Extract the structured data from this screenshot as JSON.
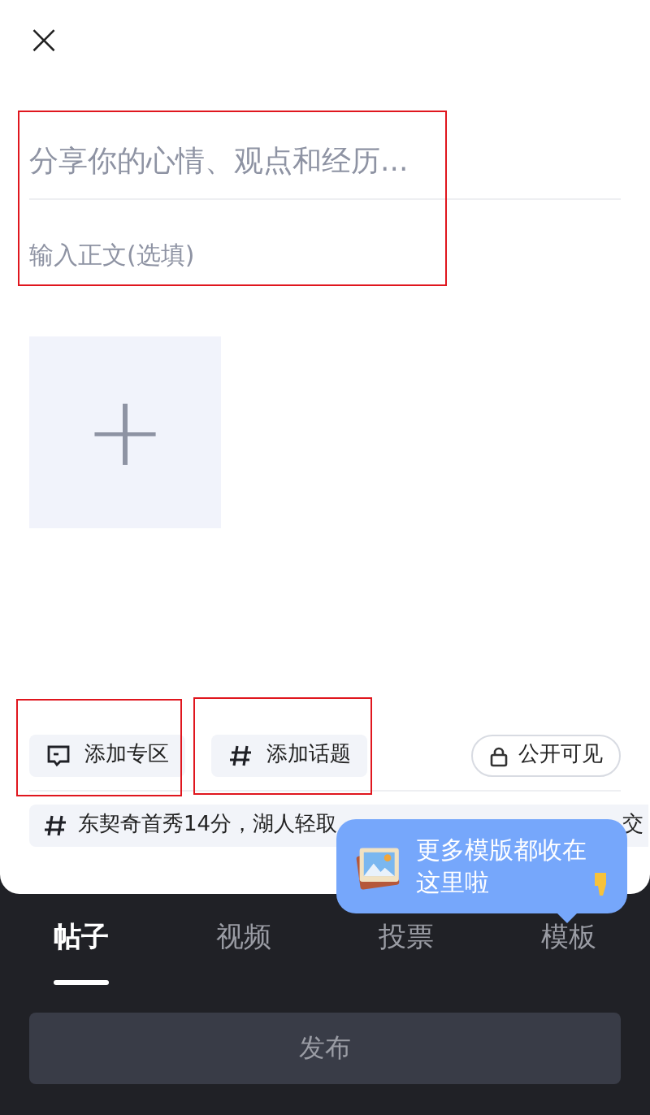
{
  "close_button": {
    "label": "×"
  },
  "title_field": {
    "placeholder": "分享你的心情、观点和经历..."
  },
  "body_field": {
    "placeholder": "输入正文(选填)"
  },
  "image_slot": {
    "label": "+"
  },
  "actions": [
    {
      "kind": "zone",
      "label": "添加专区"
    },
    {
      "kind": "topic",
      "label": "添加话题"
    }
  ],
  "visibility": {
    "label": "公开可见"
  },
  "topic_suggestions": [
    "东契奇首秀14分，湖人轻取",
    "交"
  ],
  "tooltip": {
    "text": "更多模版都收在这里啦"
  },
  "tabs": [
    {
      "label": "帖子",
      "selected": true
    },
    {
      "label": "视频",
      "selected": false
    },
    {
      "label": "投票",
      "selected": false
    },
    {
      "label": "模板",
      "selected": false
    }
  ],
  "publish_button": {
    "label": "发布",
    "disabled": true
  }
}
